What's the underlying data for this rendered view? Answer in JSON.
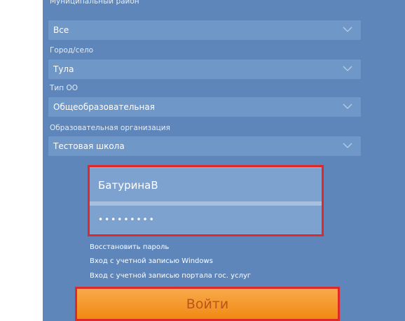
{
  "filters": [
    {
      "label": "Муниципальный район",
      "value": "Все"
    },
    {
      "label": "Город/село",
      "value": "Тула"
    },
    {
      "label": "Тип ОО",
      "value": "Общеобразовательная"
    },
    {
      "label": "Образовательная организация",
      "value": "Тестовая школа"
    }
  ],
  "login": {
    "username": "БатуринаВ",
    "password_mask": "•••••••••"
  },
  "links": {
    "restore_password": "Восстановить пароль",
    "windows_login": "Вход с учетной записью Windows",
    "gosuslugi_login": "Вход с учетной записью портала гос. услуг"
  },
  "buttons": {
    "login_label": "Войти"
  },
  "icons": {
    "dropdown": "chevron-down-icon"
  },
  "colors": {
    "panel": "#5e86ba",
    "field": "#6f97c8",
    "highlight": "#dc2a2a",
    "button": "#f5a02a"
  }
}
